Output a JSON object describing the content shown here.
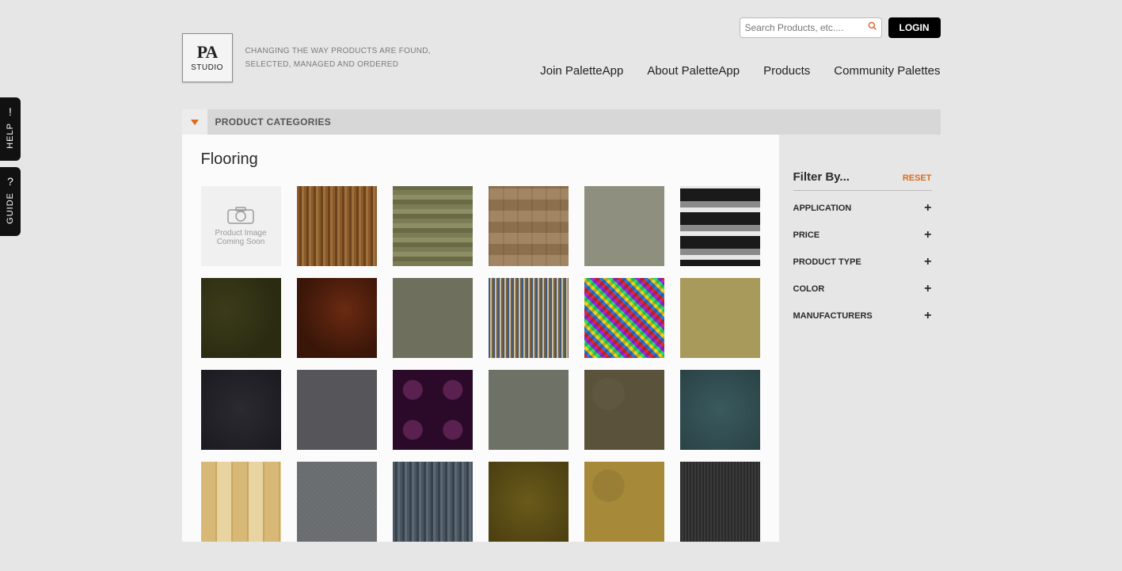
{
  "sideTabs": {
    "help": "HELP",
    "guide": "GUIDE"
  },
  "search": {
    "placeholder": "Search Products, etc...."
  },
  "login": "LOGIN",
  "logo": {
    "main": "PA",
    "sub": "STUDIO"
  },
  "tagline": {
    "line1": "CHANGING THE WAY PRODUCTS ARE FOUND,",
    "line2": "SELECTED, MANAGED AND ORDERED"
  },
  "nav": [
    "Join PaletteApp",
    "About PaletteApp",
    "Products",
    "Community Palettes"
  ],
  "categoryBar": "PRODUCT CATEGORIES",
  "pageTitle": "Flooring",
  "placeholderTile": {
    "line1": "Product Image",
    "line2": "Coming Soon"
  },
  "sidebar": {
    "title": "Filter By...",
    "reset": "RESET",
    "filters": [
      "APPLICATION",
      "PRICE",
      "PRODUCT TYPE",
      "COLOR",
      "MANUFACTURERS"
    ]
  }
}
